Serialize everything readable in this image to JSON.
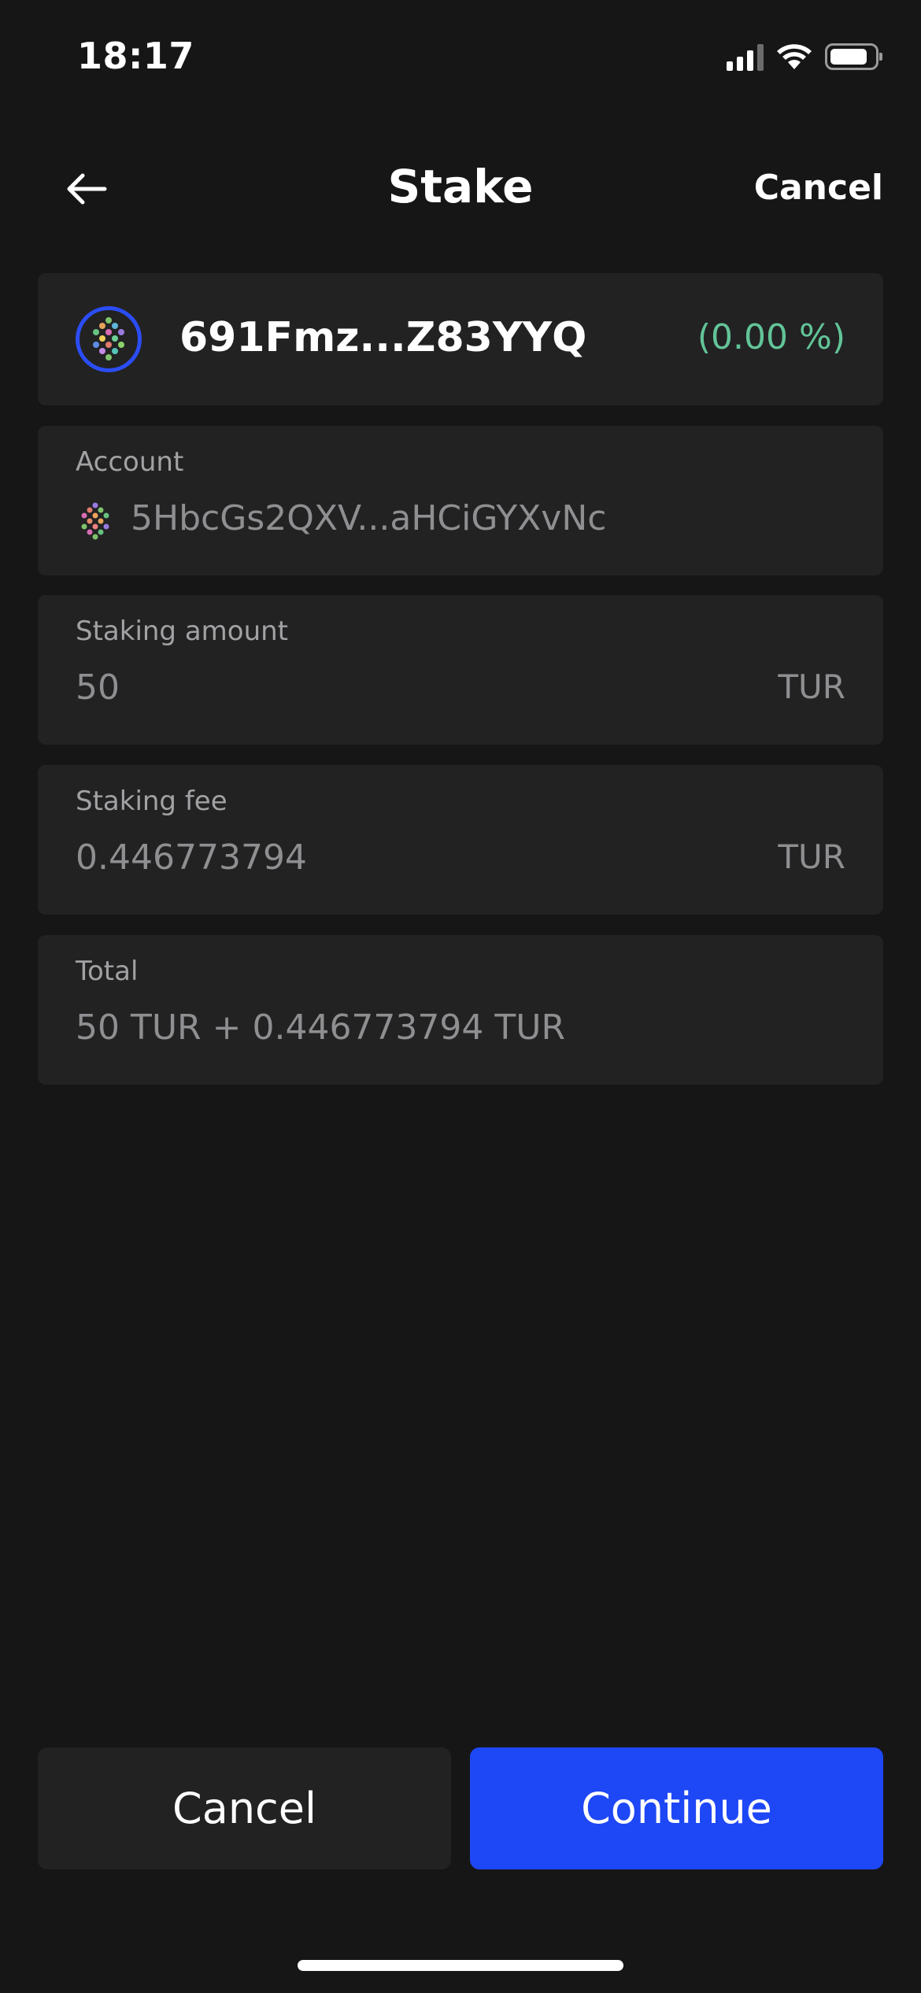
{
  "status_bar": {
    "time": "18:17"
  },
  "nav": {
    "title": "Stake",
    "cancel_label": "Cancel"
  },
  "validator": {
    "address": "691Fmz...Z83YYQ",
    "commission": "(0.00 %)"
  },
  "account": {
    "label": "Account",
    "address": "5HbcGs2QXV...aHCiGYXvNc"
  },
  "staking_amount": {
    "label": "Staking amount",
    "value": "50",
    "unit": "TUR"
  },
  "staking_fee": {
    "label": "Staking fee",
    "value": "0.446773794",
    "unit": "TUR"
  },
  "total": {
    "label": "Total",
    "value": "50 TUR + 0.446773794 TUR"
  },
  "actions": {
    "cancel_label": "Cancel",
    "continue_label": "Continue"
  },
  "colors": {
    "background": "#161617",
    "card": "#222223",
    "accent": "#1e47f5",
    "commission": "#62c498"
  },
  "icons": [
    "back-arrow-icon",
    "signal-icon",
    "wifi-icon",
    "battery-icon",
    "validator-avatar-icon",
    "account-avatar-icon"
  ]
}
